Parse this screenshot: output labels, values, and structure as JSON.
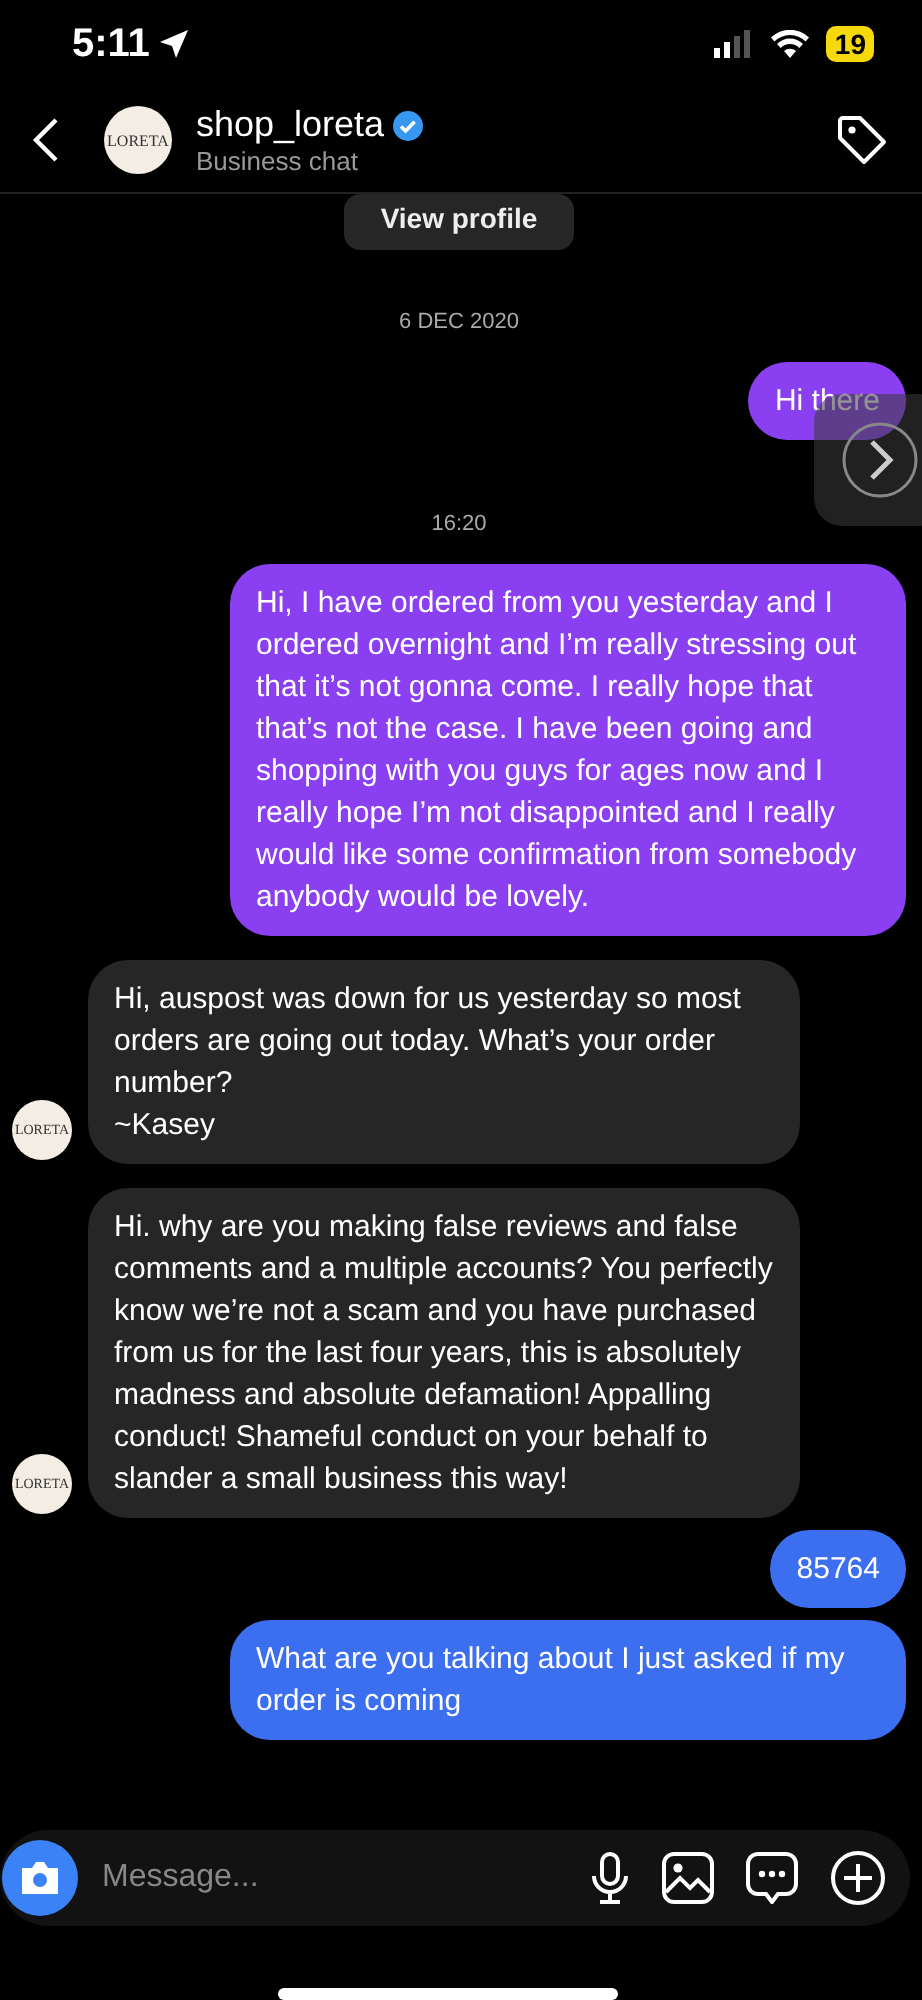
{
  "status_bar": {
    "time": "5:11",
    "battery": "19"
  },
  "header": {
    "avatar_text": "LORETA",
    "name": "shop_loreta",
    "verified": true,
    "subtitle": "Business chat"
  },
  "view_profile": "View profile",
  "messages": [
    {
      "kind": "timestamp",
      "text": "6 DEC 2020"
    },
    {
      "kind": "outgoing",
      "color": "#8a3ff0",
      "text": "Hi there",
      "overlay": true
    },
    {
      "kind": "timestamp",
      "text": "16:20"
    },
    {
      "kind": "outgoing",
      "color": "#8a3ff0",
      "text": "Hi, I have ordered from you yesterday and I ordered overnight and I’m really stressing out that it’s not gonna come. I really hope that that’s not the case. I have been going and shopping with you guys for ages now and I really hope I’m not disappointed and I really would like some confirmation from somebody anybody would be lovely."
    },
    {
      "kind": "incoming",
      "avatar_text": "LORETA",
      "text": "Hi, auspost was down for us yesterday so most orders are going out today. What’s your order number?\n~Kasey"
    },
    {
      "kind": "incoming",
      "avatar_text": "LORETA",
      "text": "Hi. why are you making false reviews and false comments and a multiple accounts? You perfectly know we’re not a scam and you have purchased from us for the last four years, this is absolutely madness and absolute defamation! Appalling conduct! Shameful conduct on your behalf to slander a small business this way!"
    },
    {
      "kind": "outgoing",
      "color": "#3b6ff0",
      "text": "85764"
    },
    {
      "kind": "outgoing",
      "color": "#3b6ff0",
      "text": "What are you talking about I just asked if my order is coming"
    }
  ],
  "composer": {
    "placeholder": "Message..."
  }
}
